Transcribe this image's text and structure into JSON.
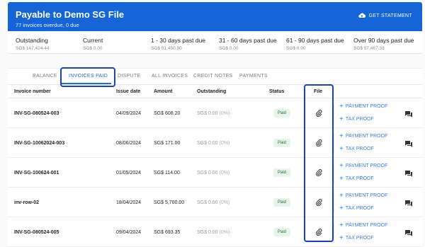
{
  "header": {
    "title": "Payable to Demo SG File",
    "subtitle": "77 invoices overdue, 0 due",
    "statement_label": "GET STATEMENT"
  },
  "summary": [
    {
      "label": "Outstanding",
      "value": "SG$ 147,424.44"
    },
    {
      "label": "Current",
      "value": "SG$ 0.00"
    },
    {
      "label": "1 - 30 days past due",
      "value": "SG$ 91,450.00"
    },
    {
      "label": "31 - 60 days past due",
      "value": "SG$ 0.00"
    },
    {
      "label": "61 - 90 days past due",
      "value": "SG$ 0.00"
    },
    {
      "label": "Over 90 days past due",
      "value": "SG$ 57,467.33"
    }
  ],
  "tabs": [
    "BALANCE",
    "INVOICES PAID",
    "DISPUTE",
    "ALL INVOICES",
    "CREDIT NOTES",
    "PAYMENTS"
  ],
  "active_tab": "INVOICES PAID",
  "columns": [
    "Invoice number",
    "Issue date",
    "Amount",
    "Outstanding",
    "Status",
    "File"
  ],
  "rows": [
    {
      "invoice": "INV-SG-080524-003",
      "date": "04/09/2024",
      "amount": "SG$ 608.20",
      "outstanding": "SG$ 0.00",
      "pct": "(0%)",
      "status": "Paid"
    },
    {
      "invoice": "INV-SG-10062024-003",
      "date": "08/06/2024",
      "amount": "SG$ 171.00",
      "outstanding": "SG$ 0.00",
      "pct": "(0%)",
      "status": "Paid"
    },
    {
      "invoice": "INV-SG-100624-001",
      "date": "01/05/2024",
      "amount": "SG$ 114.00",
      "outstanding": "SG$ 0.00",
      "pct": "(0%)",
      "status": "Paid"
    },
    {
      "invoice": "inv-row-02",
      "date": "18/04/2024",
      "amount": "SG$ 5,700.00",
      "outstanding": "SG$ 0.00",
      "pct": "(0%)",
      "status": "Paid"
    },
    {
      "invoice": "INV-SG-080524-005",
      "date": "09/04/2024",
      "amount": "SG$ 693.35",
      "outstanding": "SG$ 0.00",
      "pct": "(0%)",
      "status": "Paid"
    }
  ],
  "actions": {
    "payment_proof": "PAYMENT PROOF",
    "tax_proof": "TAX PROOF"
  },
  "icons": {
    "statement": "cloud-download-icon",
    "file": "paperclip-icon",
    "add": "plus-icon",
    "comment": "chat-icon"
  },
  "colors": {
    "header": "#1565d8",
    "accent": "#1e6fd9",
    "highlight": "#1a3ec9",
    "paid_bg": "#e6f4ea"
  }
}
